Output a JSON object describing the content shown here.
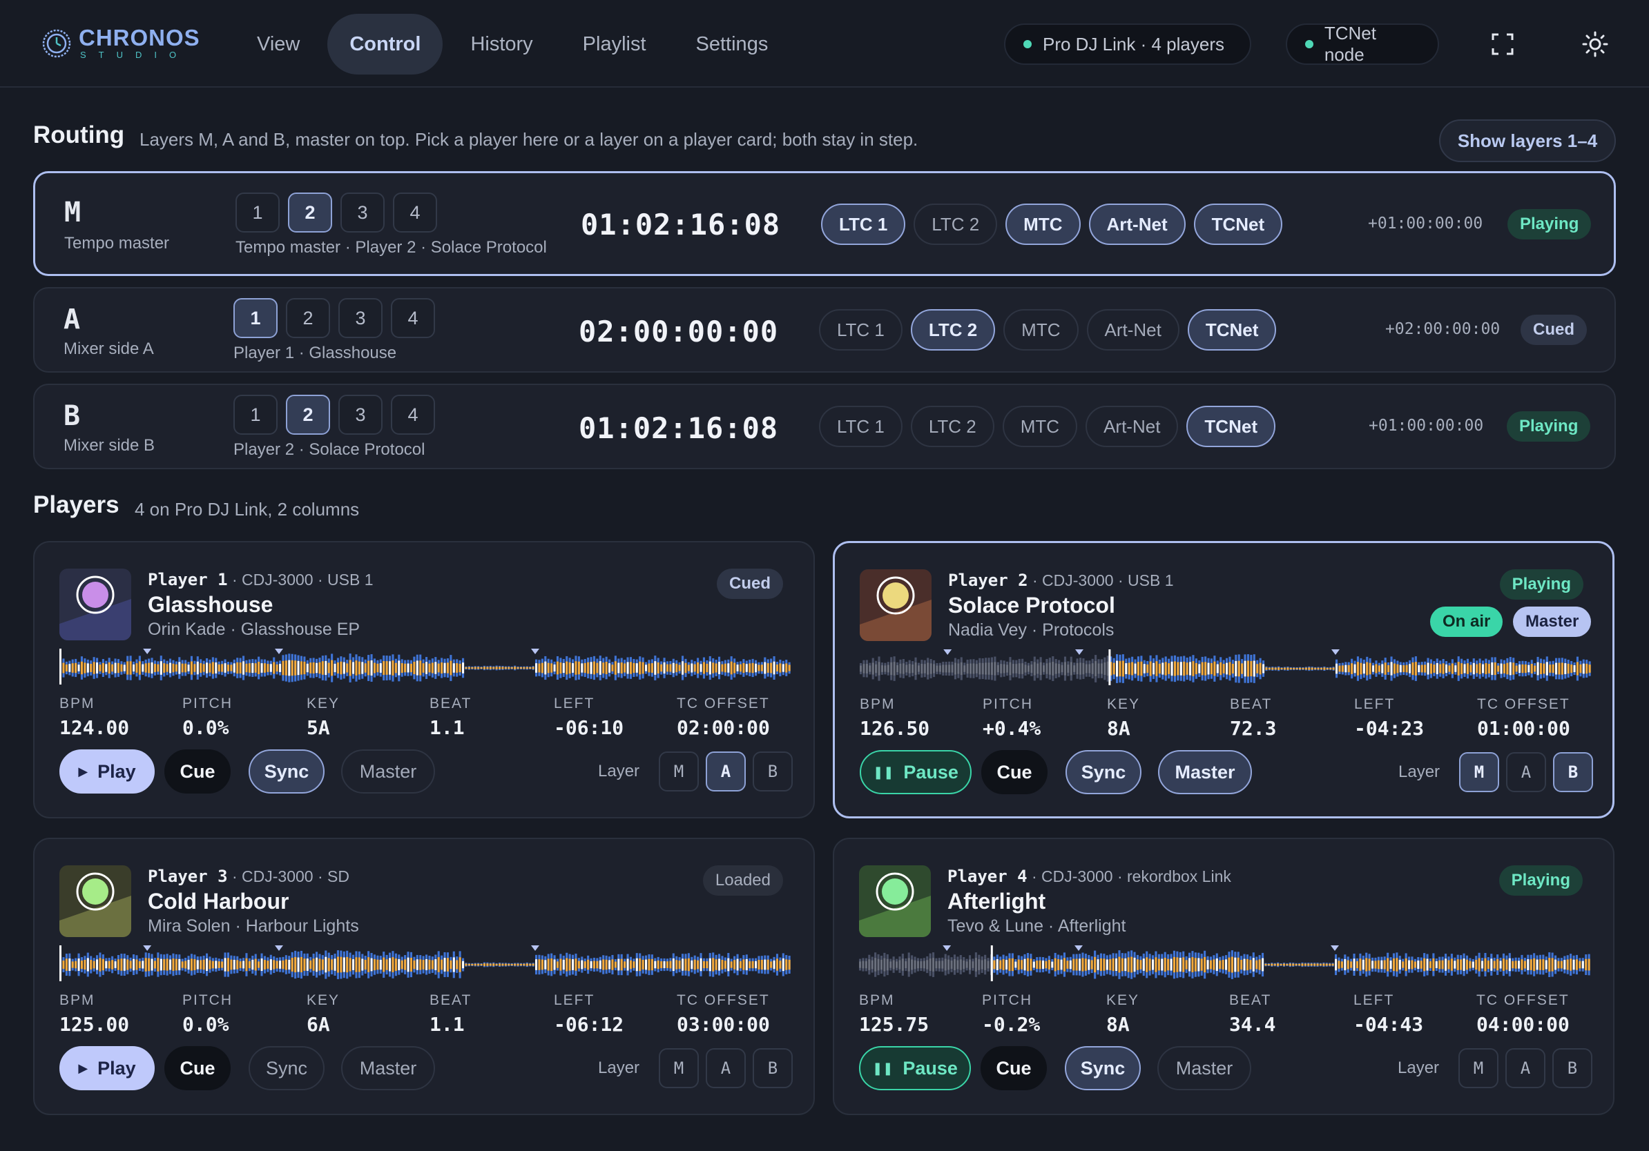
{
  "app": {
    "logo_title": "CHRONOS",
    "logo_sub": "STUDIO",
    "nav": [
      "View",
      "Control",
      "History",
      "Playlist",
      "Settings"
    ],
    "active_nav": "Control",
    "status_link": "Pro DJ Link · 4 players",
    "status_tcnet": "TCNet node",
    "icons": {
      "fullscreen": "fullscreen-icon",
      "theme": "sun-icon"
    },
    "colors": {
      "accent": "#aebff0",
      "live": "#4fd8b6",
      "bg": "#171b24"
    }
  },
  "routing": {
    "title": "Routing",
    "subtitle": "Layers M, A and B, master on top. Pick a player here or a layer on a player card; both stay in step.",
    "show_button": "Show layers 1–4",
    "players": [
      "1",
      "2",
      "3",
      "4"
    ],
    "outputs": [
      "LTC 1",
      "LTC 2",
      "MTC",
      "Art-Net",
      "TCNet"
    ],
    "rows": [
      {
        "letter": "M",
        "name": "Tempo master",
        "caption": "Tempo master · Player 2 · Solace Protocol",
        "timecode": "01:02:16:08",
        "offset": "+01:00:00:00",
        "status": "Playing",
        "player": 2,
        "outputs_on": [
          0,
          2,
          3,
          4
        ]
      },
      {
        "letter": "A",
        "name": "Mixer side A",
        "caption": "Player 1 · Glasshouse",
        "timecode": "02:00:00:00",
        "offset": "+02:00:00:00",
        "status": "Cued",
        "player": 1,
        "outputs_on": [
          1,
          4
        ]
      },
      {
        "letter": "B",
        "name": "Mixer side B",
        "caption": "Player 2 · Solace Protocol",
        "timecode": "01:02:16:08",
        "offset": "+01:00:00:00",
        "status": "Playing",
        "player": 2,
        "outputs_on": [
          4
        ]
      }
    ]
  },
  "players_section": {
    "title": "Players",
    "subtitle": "4 on Pro DJ Link, 2 columns",
    "stat_labels": [
      "BPM",
      "PITCH",
      "KEY",
      "BEAT",
      "LEFT",
      "TC OFFSET"
    ],
    "layer_label": "Layer",
    "layers": [
      "M",
      "A",
      "B"
    ],
    "controls": {
      "play": "Play",
      "pause": "Pause",
      "cue": "Cue",
      "sync": "Sync",
      "master": "Master"
    },
    "cards": [
      {
        "player": "Player 1",
        "meta": " · CDJ-3000 · USB 1",
        "title": "Glasshouse",
        "artist": "Orin Kade · Glasshouse EP",
        "status": "Cued",
        "onair": "",
        "master_badge": "",
        "stats": [
          "124.00",
          "0.0%",
          "5A",
          "1.1",
          "-06:10",
          "02:00:00"
        ],
        "playing": false,
        "sync_on": true,
        "master_on": false,
        "layers_on": [
          "A"
        ],
        "progress": 0.0,
        "art_color": "#c98ee8"
      },
      {
        "player": "Player 2",
        "meta": " · CDJ-3000 · USB 1",
        "title": "Solace Protocol",
        "artist": "Nadia Vey · Protocols",
        "status": "Playing",
        "onair": "On air",
        "master_badge": "Master",
        "stats": [
          "126.50",
          "+0.4%",
          "8A",
          "72.3",
          "-04:23",
          "01:00:00"
        ],
        "playing": true,
        "sync_on": true,
        "master_on": true,
        "layers_on": [
          "M",
          "B"
        ],
        "progress": 0.34,
        "art_color": "#ecd97e"
      },
      {
        "player": "Player 3",
        "meta": " · CDJ-3000 · SD",
        "title": "Cold Harbour",
        "artist": "Mira Solen · Harbour Lights",
        "status": "Loaded",
        "onair": "",
        "master_badge": "",
        "stats": [
          "125.00",
          "0.0%",
          "6A",
          "1.1",
          "-06:12",
          "03:00:00"
        ],
        "playing": false,
        "sync_on": false,
        "master_on": false,
        "layers_on": [],
        "progress": 0.0,
        "art_color": "#a6ec88"
      },
      {
        "player": "Player 4",
        "meta": " · CDJ-3000 · rekordbox Link",
        "title": "Afterlight",
        "artist": "Tevo & Lune · Afterlight",
        "status": "Playing",
        "onair": "",
        "master_badge": "",
        "stats": [
          "125.75",
          "-0.2%",
          "8A",
          "34.4",
          "-04:43",
          "04:00:00"
        ],
        "playing": true,
        "sync_on": true,
        "master_on": false,
        "layers_on": [],
        "progress": 0.18,
        "art_color": "#86ec9a"
      }
    ]
  }
}
